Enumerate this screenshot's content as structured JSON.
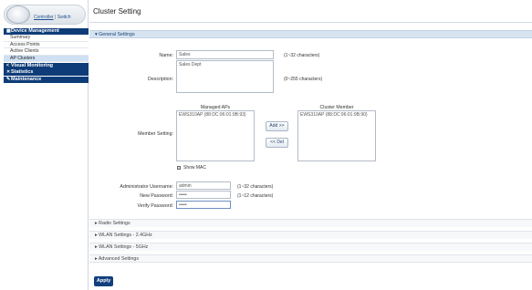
{
  "sidebar": {
    "controller_link": "Controller",
    "separator": "|",
    "switch_link": "Switch",
    "device_management": "Device Management",
    "items": [
      "Summary",
      "Access Points",
      "Active Clients",
      "AP Clusters"
    ],
    "visual_monitoring": "Visual Monitoring",
    "statistics": "Statistics",
    "maintenance": "Maintenance"
  },
  "page": {
    "title": "Cluster Setting"
  },
  "general": {
    "header": "General Settings",
    "name_label": "Name:",
    "name_value": "Sales",
    "name_hint": "(1~32 characters)",
    "description_label": "Description:",
    "description_value": "Sales Dept",
    "description_hint": "(0~255 characters)",
    "member_setting_label": "Member Setting:",
    "managed_aps_title": "Managed APs",
    "managed_aps": [
      "EWS310AP (88:DC:96:01:9B:93)"
    ],
    "cluster_member_title": "Cluster Member",
    "cluster_members": [
      "EWS310AP (88:DC:96:01:9B:90)"
    ],
    "add_button": "Add >>",
    "del_button": "<< Del",
    "show_mac_label": "Show MAC",
    "admin_username_label": "Administrator Username:",
    "admin_username_value": "admin",
    "admin_username_hint": "(1~32 characters)",
    "new_password_label": "New Password:",
    "new_password_value": "•••••",
    "new_password_hint": "(1~12 characters)",
    "verify_password_label": "Verify Password:",
    "verify_password_value": "•••••"
  },
  "sections": [
    "Radio Settings",
    "WLAN Settings - 2.4GHz",
    "WLAN Settings - 5GHz",
    "Advanced Settings"
  ],
  "apply_button": "Apply",
  "colors": {
    "nav_header": "#0e3c78",
    "section_header": "#d6e4f2",
    "active_item": "#cfe0f3",
    "apply": "#123f7d"
  }
}
